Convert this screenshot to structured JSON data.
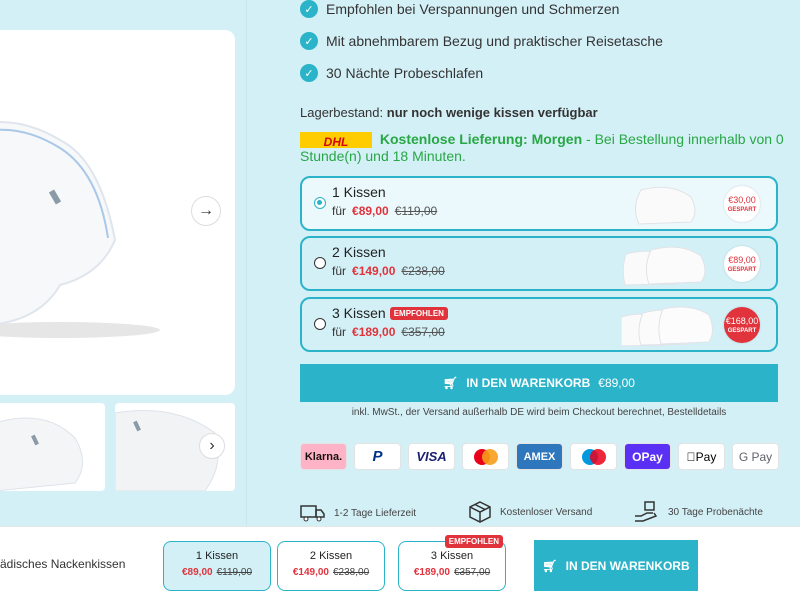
{
  "bullets": [
    "Empfohlen bei Verspannungen und Schmerzen",
    "Mit abnehmbarem Bezug und praktischer Reisetasche",
    "30 Nächte Probeschlafen"
  ],
  "stock": {
    "label": "Lagerbestand:",
    "value": "nur noch wenige kissen verfügbar"
  },
  "delivery": {
    "carrier": "DHL",
    "headline": "Kostenlose Lieferung: Morgen",
    "detail": "- Bei Bestellung innerhalb von 0 Stunde(n) und 18 Minuten."
  },
  "options": [
    {
      "title": "1 Kissen",
      "prefix": "für",
      "price": "€89,00",
      "old_price": "€119,00",
      "save": "€30,00",
      "save_label": "GESPART",
      "badge": "",
      "selected": true
    },
    {
      "title": "2 Kissen",
      "prefix": "für",
      "price": "€149,00",
      "old_price": "€238,00",
      "save": "€89,00",
      "save_label": "GESPART",
      "badge": "",
      "selected": false
    },
    {
      "title": "3 Kissen",
      "prefix": "für",
      "price": "€189,00",
      "old_price": "€357,00",
      "save": "€168,00",
      "save_label": "GESPART",
      "badge": "EMPFOHLEN",
      "selected": false
    }
  ],
  "cart": {
    "label": "IN DEN WARENKORB",
    "price": "€89,00"
  },
  "tax_note": "inkl. MwSt., der Versand außerhalb DE wird beim Checkout berechnet, Bestelldetails",
  "payments": [
    "Klarna.",
    "P",
    "VISA",
    "mastercard",
    "AMEX",
    "maestro",
    "OPay",
    "Pay",
    "G Pay"
  ],
  "features": [
    "1-2 Tage Lieferzeit",
    "Kostenloser Versand",
    "30 Tage Probenächte"
  ],
  "sticky": {
    "product_title": "ädisches Nackenkissen",
    "cart_label": "IN DEN WARENKORB"
  },
  "colors": {
    "accent": "#2bb4c9",
    "price_red": "#e0333c",
    "delivery_green": "#28a745",
    "background": "#d4f0f7"
  }
}
